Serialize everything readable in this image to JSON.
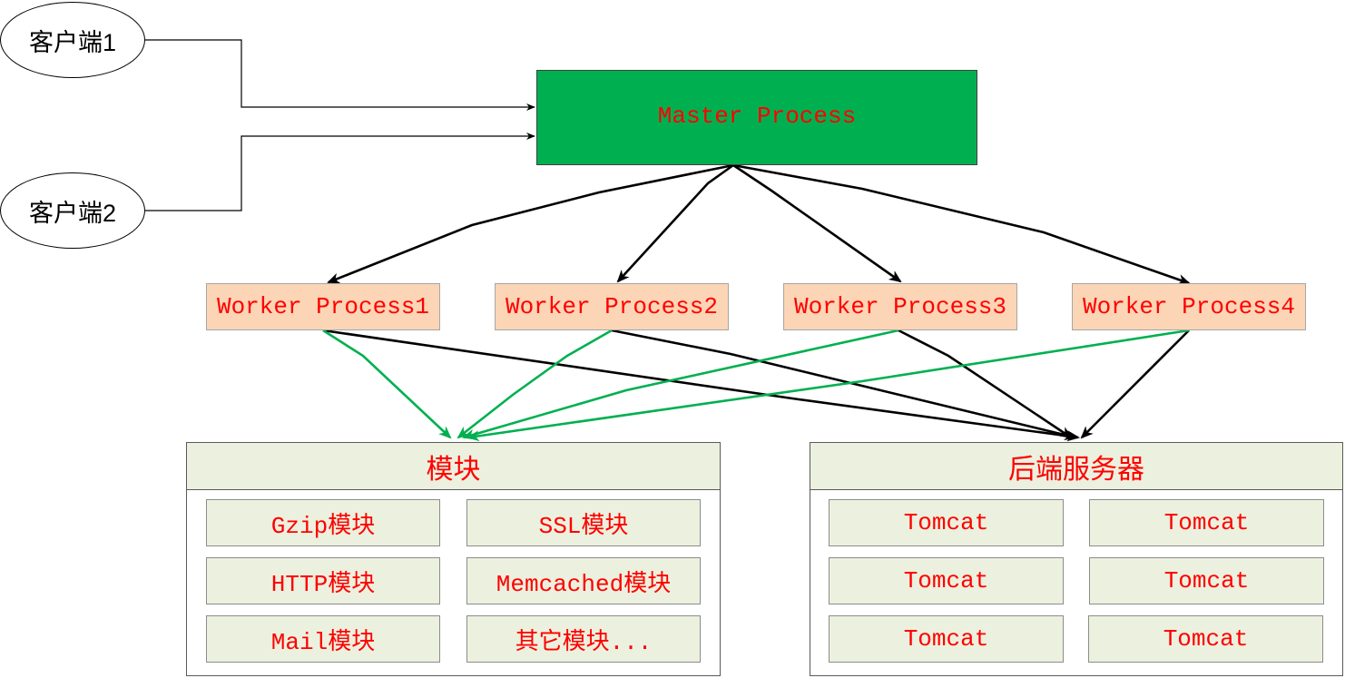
{
  "clients": [
    {
      "label": "客户端1"
    },
    {
      "label": "客户端2"
    }
  ],
  "master": {
    "label": "Master Process"
  },
  "workers": [
    {
      "label": "Worker Process1"
    },
    {
      "label": "Worker Process2"
    },
    {
      "label": "Worker Process3"
    },
    {
      "label": "Worker Process4"
    }
  ],
  "modules": {
    "title": "模块",
    "items": [
      "Gzip模块",
      "SSL模块",
      "HTTP模块",
      "Memcached模块",
      "Mail模块",
      "其它模块..."
    ]
  },
  "backend": {
    "title": "后端服务器",
    "items": [
      "Tomcat",
      "Tomcat",
      "Tomcat",
      "Tomcat",
      "Tomcat",
      "Tomcat"
    ]
  },
  "colors": {
    "master_fill": "#00b050",
    "worker_fill": "#fbd5b5",
    "module_fill": "#ebf1de",
    "label_text": "#ff0000",
    "green_line": "#00b050"
  }
}
